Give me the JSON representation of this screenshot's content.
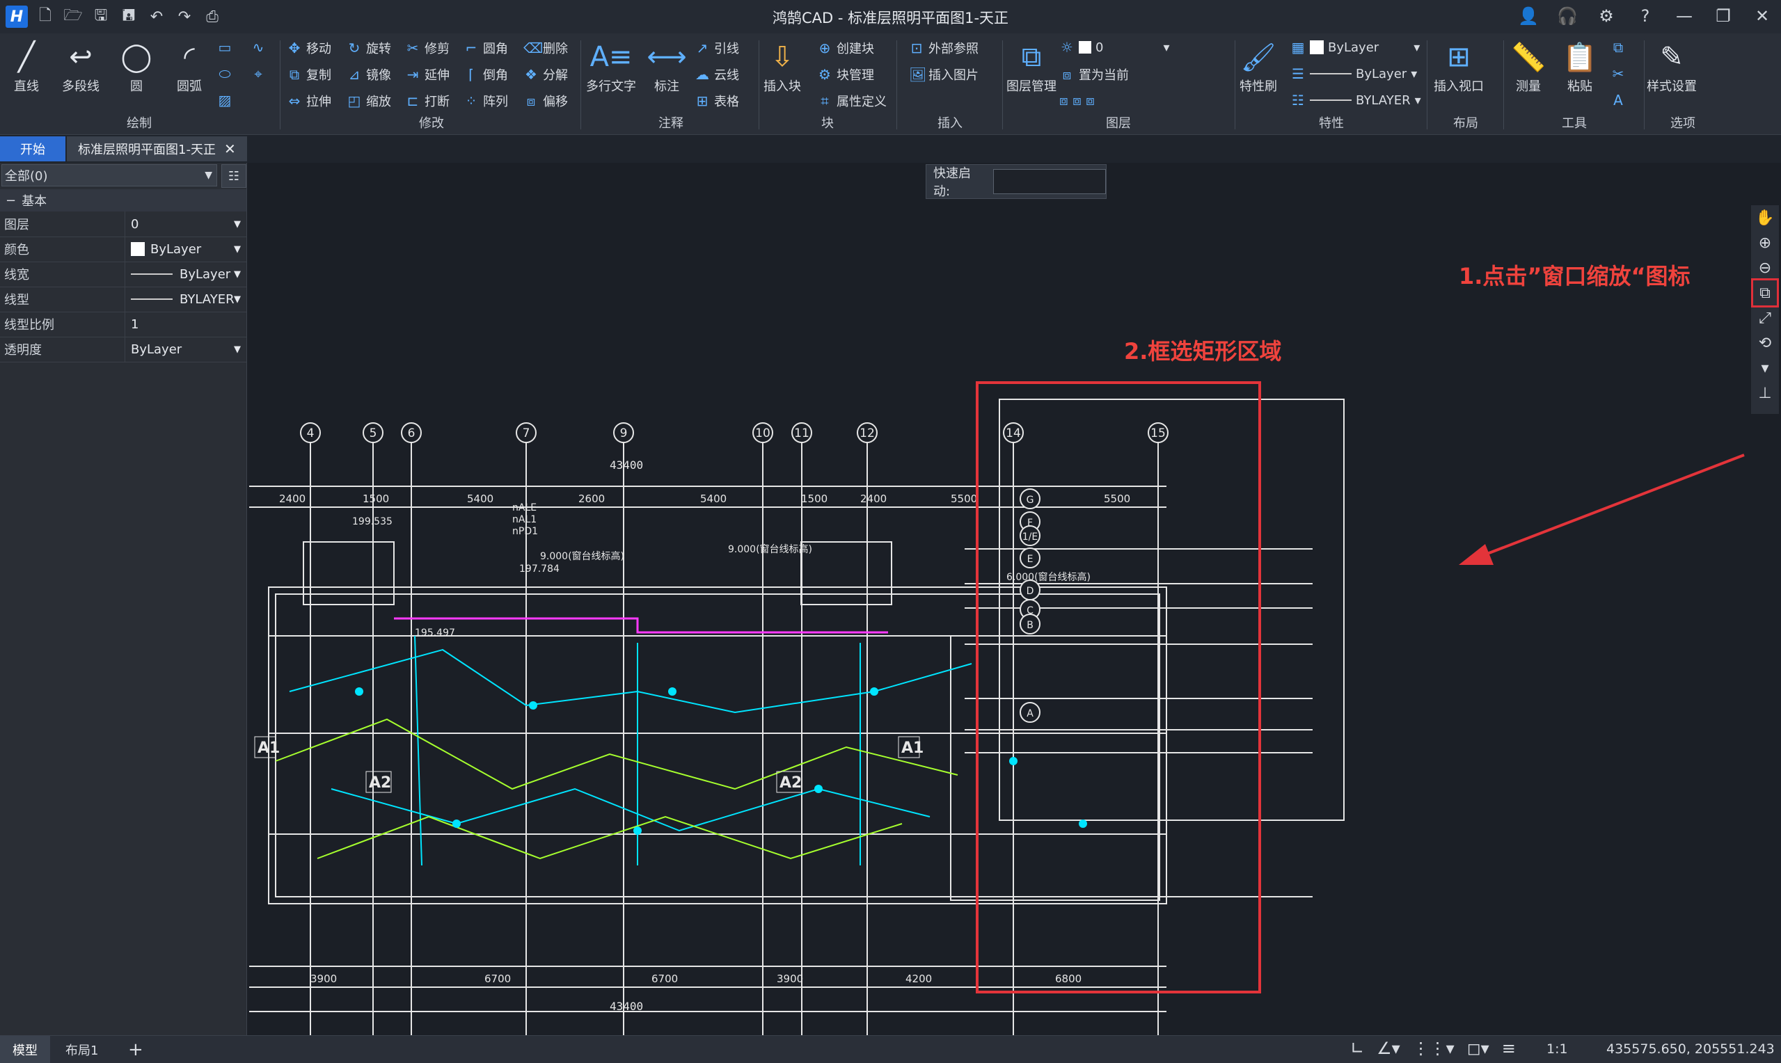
{
  "title": "鸿鹄CAD - 标准层照明平面图1-天正",
  "ribbon": {
    "draw": {
      "line": "直线",
      "polyline": "多段线",
      "circle": "圆",
      "arc": "圆弧",
      "group": "绘制"
    },
    "modify": {
      "move": "移动",
      "rotate": "旋转",
      "trim": "修剪",
      "fillet": "圆角",
      "erase": "删除",
      "copy": "复制",
      "mirror": "镜像",
      "extend": "延伸",
      "chamfer": "倒角",
      "explode": "分解",
      "stretch": "拉伸",
      "scale": "缩放",
      "break": "打断",
      "array": "阵列",
      "offset": "偏移",
      "group": "修改"
    },
    "annot": {
      "mtext": "多行文字",
      "dim": "标注",
      "leader": "引线",
      "cloud": "云线",
      "table": "表格",
      "group": "注释"
    },
    "block": {
      "insert": "插入块",
      "create": "创建块",
      "manage": "块管理",
      "attdef": "属性定义",
      "group": "块"
    },
    "insert": {
      "xref": "外部参照",
      "image": "插入图片",
      "group": "插入"
    },
    "layer": {
      "manager": "图层管理",
      "current_layer": "0",
      "set_current": "置为当前",
      "group": "图层"
    },
    "props": {
      "brush": "特性刷",
      "color": "ByLayer",
      "lineweight": "ByLayer",
      "linetype": "BYLAYER",
      "group": "特性"
    },
    "layout": {
      "viewport": "插入视口",
      "group": "布局"
    },
    "tools": {
      "measure": "测量",
      "paste": "粘贴",
      "group": "工具"
    },
    "options": {
      "style": "样式设置",
      "group": "选项"
    }
  },
  "tabs": {
    "start": "开始",
    "doc": "标准层照明平面图1-天正"
  },
  "panel": {
    "filter": "全部(0)",
    "section": "基本",
    "rows": [
      {
        "k": "图层",
        "v": "0"
      },
      {
        "k": "颜色",
        "v": "ByLayer"
      },
      {
        "k": "线宽",
        "v": "ByLayer"
      },
      {
        "k": "线型",
        "v": "BYLAYER"
      },
      {
        "k": "线型比例",
        "v": "1"
      },
      {
        "k": "透明度",
        "v": "ByLayer"
      }
    ]
  },
  "quick_start": "快速启动:",
  "annotations": {
    "step1": "1.点击”窗口缩放“图标",
    "step2": "2.框选矩形区域"
  },
  "drawing": {
    "axes_top": [
      "4",
      "5",
      "6",
      "7",
      "9",
      "10",
      "11",
      "12",
      "14",
      "15"
    ],
    "axes_right": [
      "G",
      "F",
      "1/E",
      "E",
      "D",
      "C",
      "B",
      "A"
    ],
    "dims_top": [
      "2400",
      "1500",
      "5400",
      "2600",
      "5400",
      "1500",
      "2400",
      "5500",
      "5500"
    ],
    "total": "43400",
    "dims_bottom": [
      "3900",
      "6700",
      "6700",
      "3900",
      "4200",
      "6800"
    ],
    "elev": [
      "9.000(窗台线标高)",
      "6.000(窗台线标高)"
    ],
    "room_tags": [
      "A1",
      "A2",
      "A2",
      "A1"
    ],
    "labels": [
      "nALE",
      "nAL1",
      "nPD1",
      "199.535",
      "197.784",
      "195.497"
    ]
  },
  "status": {
    "model": "模型",
    "layout1": "布局1",
    "scale": "1:1",
    "coords": "435575.650, 205551.243"
  }
}
